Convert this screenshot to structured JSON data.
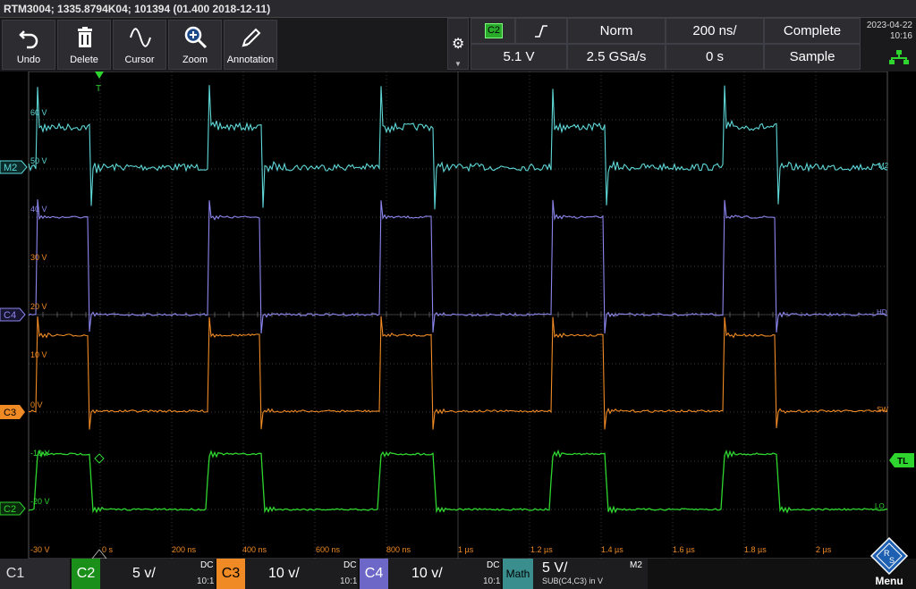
{
  "titlebar": {
    "text": "RTM3004; 1335.8794K04; 101394 (01.400 2018-12-11)"
  },
  "toolbar": {
    "undo": "Undo",
    "delete": "Delete",
    "cursor": "Cursor",
    "zoom": "Zoom",
    "annotation": "Annotation"
  },
  "trigger": {
    "source": "C2",
    "slope_icon": "rising-edge-icon",
    "mode": "Norm",
    "timebase": "200 ns/",
    "acq_status": "Complete",
    "level": "5.1 V",
    "sample_rate": "2.5 GSa/s",
    "position": "0 s",
    "acq_mode": "Sample"
  },
  "datetime": {
    "date": "2023-04-22",
    "time": "10:16"
  },
  "screen": {
    "markers": {
      "m2": "M2",
      "c4": "C4",
      "c3": "C3",
      "c2": "C2",
      "tl": "TL",
      "trigger_t": "T"
    },
    "trace_labels": {
      "m2_right": "M2",
      "hd": "HD",
      "sw": "SW",
      "lo": "LO"
    },
    "y_labels": [
      "60 V",
      "50 V",
      "40 V",
      "30 V",
      "20 V",
      "10 V",
      "0 V",
      "-10 V",
      "-20 V",
      "-30 V"
    ],
    "x_labels": [
      "0 s",
      "200 ns",
      "400 ns",
      "600 ns",
      "800 ns",
      "1 µs",
      "1.2 µs",
      "1.4 µs",
      "1.6 µs",
      "1.8 µs",
      "2 µs"
    ],
    "colors": {
      "m2": "#5fd8d8",
      "c4": "#8c86ee",
      "c3": "#f08a24",
      "c2": "#2fd52f"
    }
  },
  "bottombar": {
    "c1": {
      "tag": "C1"
    },
    "c2": {
      "tag": "C2",
      "scale": "5 v/",
      "coupling": "DC",
      "ratio": "10:1"
    },
    "c3": {
      "tag": "C3",
      "scale": "10 v/",
      "coupling": "DC",
      "ratio": "10:1"
    },
    "c4": {
      "tag": "C4",
      "scale": "10 v/",
      "coupling": "DC",
      "ratio": "10:1"
    },
    "math": {
      "tag": "Math",
      "scale": "5 V/",
      "expr": "SUB(C4,C3) in V",
      "name": "M2"
    },
    "menu": "Menu"
  }
}
